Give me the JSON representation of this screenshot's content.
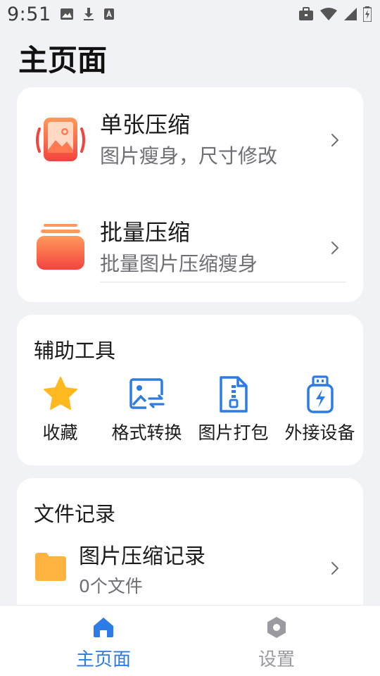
{
  "status_bar": {
    "time": "9:51",
    "icons_left": [
      "image-icon",
      "download-icon",
      "keyboard-a-icon"
    ],
    "icons_right": [
      "briefcase-icon",
      "wifi-icon",
      "signal-icon",
      "battery-charging-icon"
    ]
  },
  "page_title": "主页面",
  "compress": {
    "single": {
      "title": "单张压缩",
      "subtitle": "图片瘦身，尺寸修改",
      "icon": "image-compress-icon"
    },
    "batch": {
      "title": "批量压缩",
      "subtitle": "批量图片压缩瘦身",
      "icon": "batch-stack-icon"
    }
  },
  "tools": {
    "title": "辅助工具",
    "items": [
      {
        "label": "收藏",
        "icon": "star-icon"
      },
      {
        "label": "格式转换",
        "icon": "image-convert-icon"
      },
      {
        "label": "图片打包",
        "icon": "zip-file-icon"
      },
      {
        "label": "外接设备",
        "icon": "usb-device-icon"
      }
    ]
  },
  "records": {
    "title": "文件记录",
    "items": [
      {
        "title": "图片压缩记录",
        "subtitle": "0个文件",
        "icon": "folder-icon"
      }
    ]
  },
  "bottom_nav": {
    "items": [
      {
        "label": "主页面",
        "icon": "home-icon",
        "active": true
      },
      {
        "label": "设置",
        "icon": "settings-icon",
        "active": false
      }
    ]
  },
  "colors": {
    "accent": "#2d7be5",
    "gradient_start": "#ff9457",
    "gradient_end": "#f5433f",
    "folder": "#ffb340",
    "star": "#ffb820",
    "inactive": "#9a9aa0"
  }
}
